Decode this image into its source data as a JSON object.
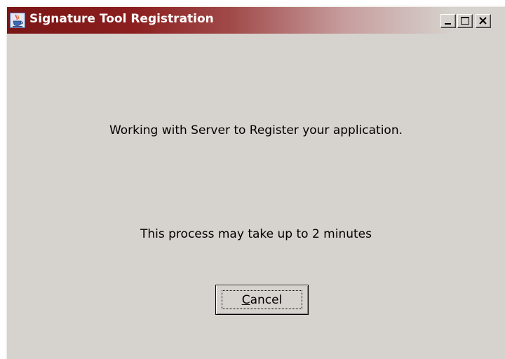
{
  "window": {
    "title": "Signature Tool Registration",
    "icon": "java-cup-icon",
    "controls": {
      "minimize": "minimize-icon",
      "maximize": "maximize-icon",
      "close": "close-icon"
    }
  },
  "content": {
    "message_line1": "Working with Server to Register your application.",
    "message_line2": "This process may take up to 2 minutes"
  },
  "buttons": {
    "cancel_mnemonic": "C",
    "cancel_rest": "ancel"
  },
  "colors": {
    "title_active_start": "#7a1515",
    "window_background": "#d6d3ce"
  }
}
